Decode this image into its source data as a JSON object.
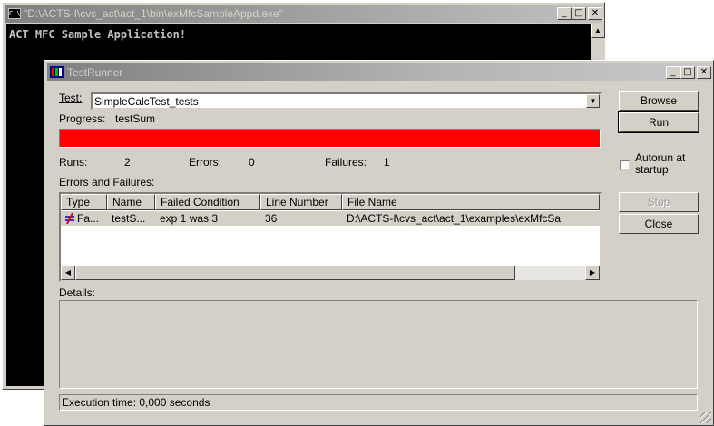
{
  "console": {
    "title": "\"D:\\ACTS-I\\cvs_act\\act_1\\bin\\exMfcSampleAppd.exe\"",
    "output": "ACT MFC Sample Application!"
  },
  "runner": {
    "title": "TestRunner",
    "test_label": "Test:",
    "test_value": "SimpleCalcTest_tests",
    "progress_label": "Progress:",
    "progress_test": "testSum",
    "progress_fraction": 1.0,
    "progress_color": "#ff0000",
    "runs_label": "Runs:",
    "runs": "2",
    "errors_label": "Errors:",
    "errors": "0",
    "failures_label": "Failures:",
    "failures": "1",
    "errors_failures_label": "Errors and Failures:",
    "columns": [
      "Type",
      "Name",
      "Failed Condition",
      "Line Number",
      "File Name"
    ],
    "rows": [
      {
        "type": "Fa...",
        "name": "testS...",
        "condition": "exp 1 was 3",
        "line": "36",
        "file": "D:\\ACTS-I\\cvs_act\\act_1\\examples\\exMfcSa"
      }
    ],
    "details_label": "Details:",
    "status": "Execution time: 0,000 seconds",
    "buttons": {
      "browse": "Browse",
      "run": "Run",
      "stop": "Stop",
      "close": "Close"
    },
    "autorun": "Autorun at startup",
    "autorun_line1": "Autorun at",
    "autorun_line2": "startup"
  },
  "icons": [
    "console-icon",
    "testrunner-icon",
    "minimize-icon",
    "maximize-icon",
    "close-icon",
    "dropdown-arrow-icon",
    "failure-icon",
    "scroll-left-icon",
    "scroll-right-icon",
    "scroll-up-icon",
    "resize-grip-icon"
  ]
}
